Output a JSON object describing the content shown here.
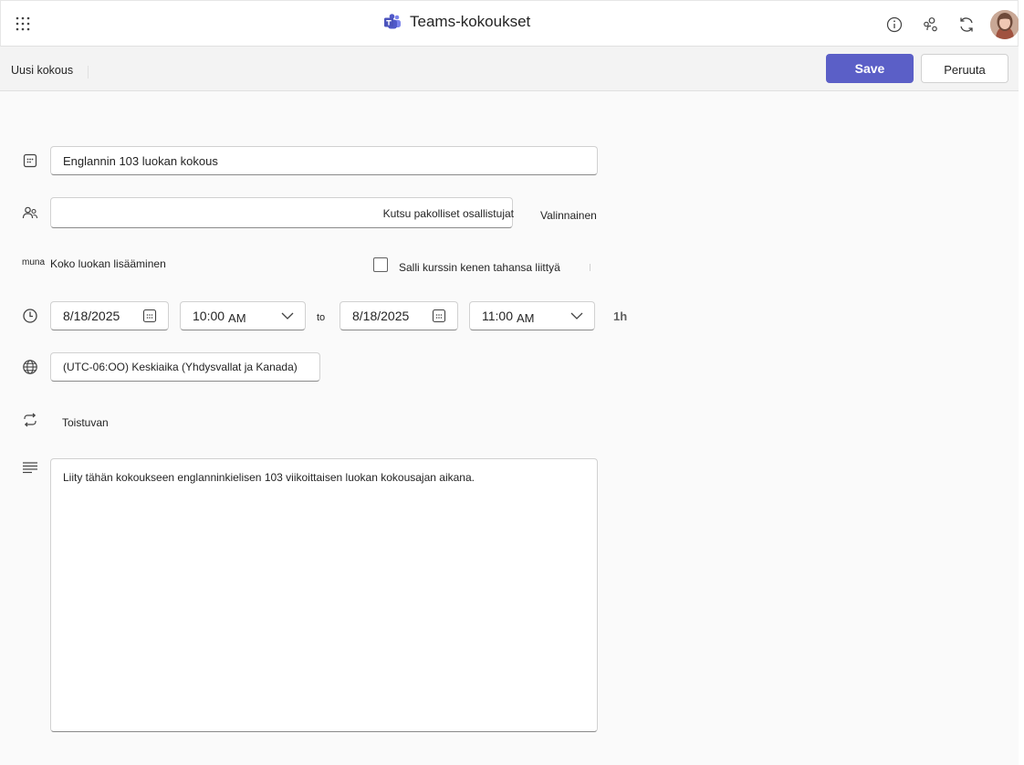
{
  "header": {
    "app_title": "Teams-kokoukset"
  },
  "command_bar": {
    "title": "Uusi kokous",
    "save_label": "Save",
    "cancel_label": "Peruuta"
  },
  "form": {
    "title_value": "Englannin 103 luokan kokous",
    "attendees_placeholder": "Kutsu pakolliset osallistujat",
    "optional_label": "Valinnainen",
    "class_prefix": "muna",
    "add_class_label": "Koko luokan lisääminen",
    "allow_join_label": "Salli kurssin kenen tahansa liittyä",
    "start_date": "8/18/2025",
    "start_time": "10:00",
    "start_ampm": "AM",
    "to_label": "to",
    "end_date": "8/18/2025",
    "end_time": "11:00",
    "end_ampm": "AM",
    "duration": "1h",
    "timezone": "(UTC-06:OO) Keskiaika (Yhdysvallat ja Kanada)",
    "recurring_label": "Toistuvan",
    "description": "Liity tähän kokoukseen englanninkielisen 103 viikoittaisen luokan kokousajan aikana."
  },
  "icons": {
    "waffle": "app-launcher-icon",
    "teams": "teams-logo-icon",
    "info": "info-icon",
    "people_settings": "people-settings-icon",
    "refresh": "refresh-icon",
    "calendar": "calendar-icon",
    "people": "people-icon",
    "clock": "clock-icon",
    "globe": "globe-icon",
    "repeat": "repeat-icon",
    "text": "text-align-icon"
  },
  "colors": {
    "accent": "#5b5fc7"
  }
}
